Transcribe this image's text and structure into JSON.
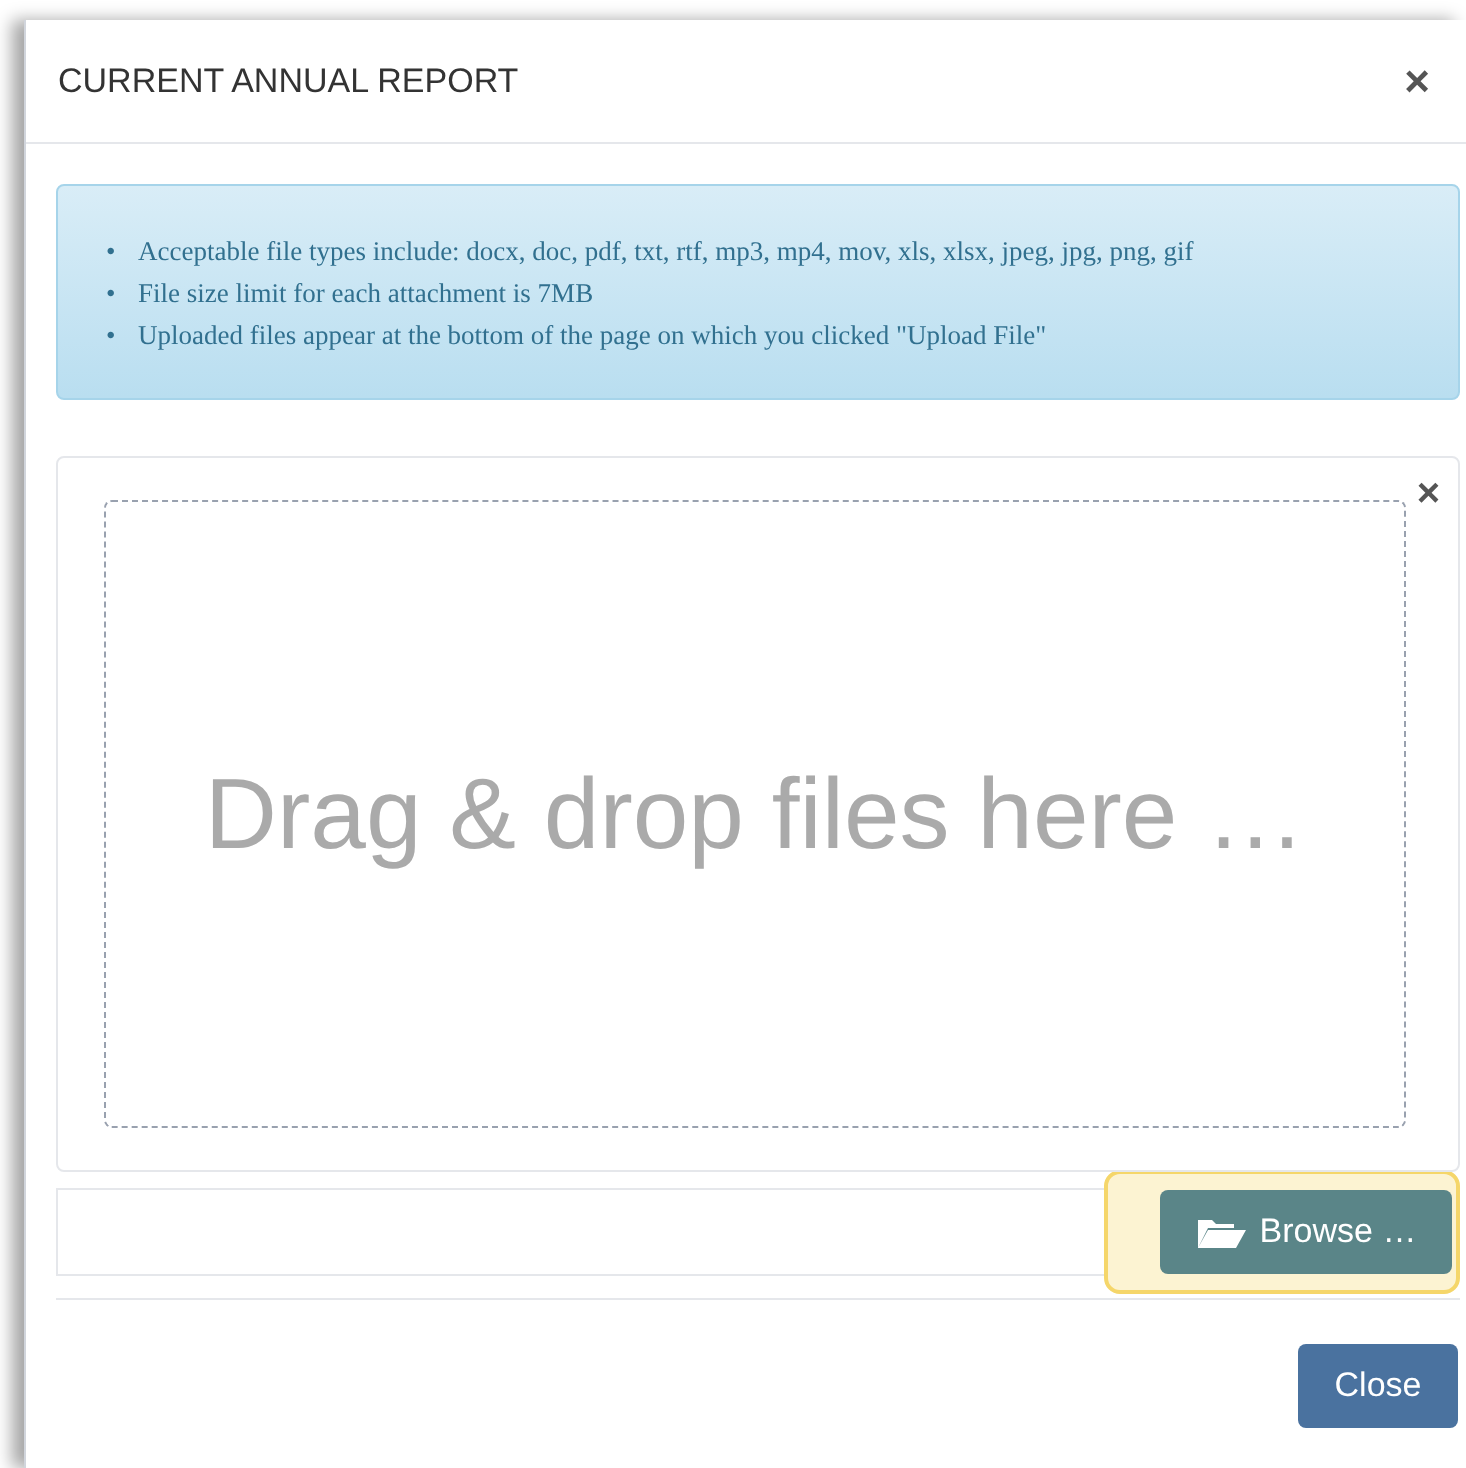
{
  "modal": {
    "title": "CURRENT ANNUAL REPORT",
    "close_icon": "×"
  },
  "info": {
    "bullet": "•",
    "items": [
      "Acceptable file types include: docx, doc, pdf, txt, rtf, mp3, mp4, mov, xls, xlsx, jpeg, jpg, png, gif",
      "File size limit for each attachment is 7MB",
      "Uploaded files appear at the bottom of the page on which you clicked \"Upload File\""
    ]
  },
  "dropzone": {
    "remove_icon": "×",
    "prompt": "Drag & drop files here …"
  },
  "file_input": {
    "browse_label": "Browse …",
    "focused": true
  },
  "footer": {
    "close_label": "Close"
  }
}
